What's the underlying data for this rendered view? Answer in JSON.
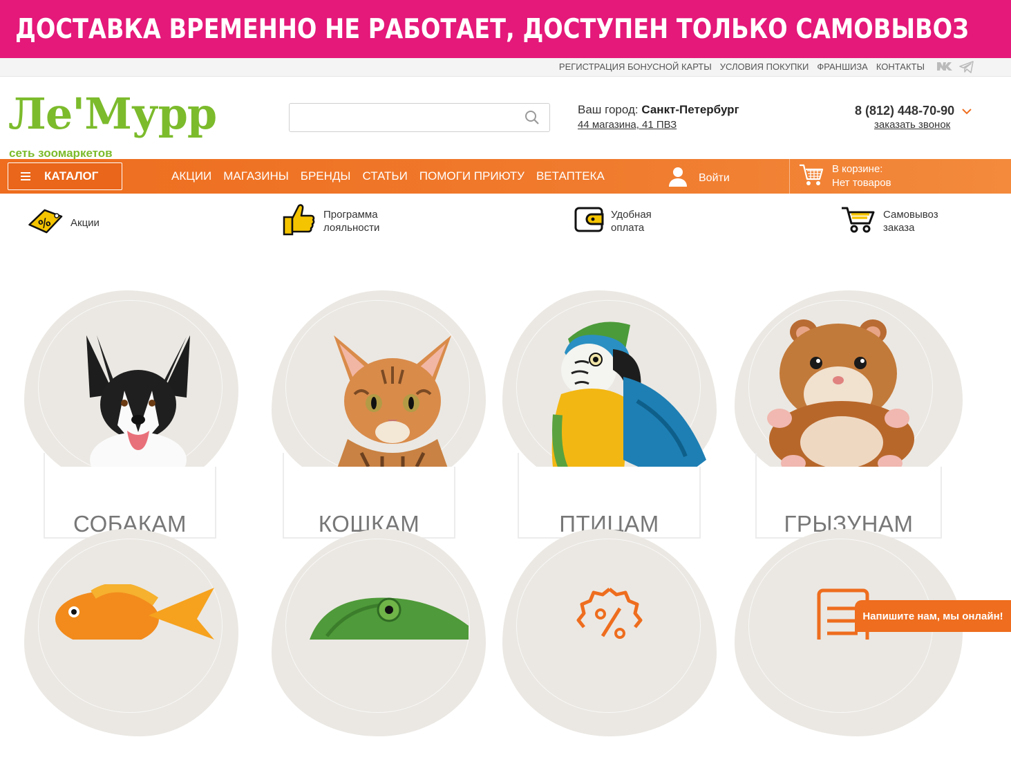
{
  "banner": {
    "text": "ДОСТАВКА ВРЕМЕННО НЕ РАБОТАЕТ, ДОСТУПЕН ТОЛЬКО САМОВЫВОЗ",
    "color": "#e4197a"
  },
  "toplinks": [
    "РЕГИСТРАЦИЯ БОНУСНОЙ КАРТЫ",
    "УСЛОВИЯ ПОКУПКИ",
    "ФРАНШИЗА",
    "КОНТАКТЫ"
  ],
  "social": [
    "vk-icon",
    "telegram-icon"
  ],
  "logo": {
    "main": "Ле'Мурр",
    "sub": "сеть зоомаркетов",
    "color": "#7cbb2c"
  },
  "search": {
    "value": "",
    "placeholder": ""
  },
  "city": {
    "label": "Ваш город:",
    "name": "Санкт-Петербург",
    "stores": "44 магазина, 41 ПВЗ"
  },
  "phone": {
    "number": "8 (812) 448-70-90",
    "callback": "заказать звонок"
  },
  "nav": {
    "catalog": "КАТАЛОГ",
    "items": [
      "АКЦИИ",
      "МАГАЗИНЫ",
      "БРЕНДЫ",
      "СТАТЬИ",
      "ПОМОГИ ПРИЮТУ",
      "ВЕТАПТЕКА"
    ],
    "login": "Войти",
    "cart_title": "В корзине:",
    "cart_status": "Нет товаров",
    "accent": "#ee6d1e"
  },
  "features": [
    {
      "l1": "Акции",
      "l2": "",
      "icon": "discount-tag-icon"
    },
    {
      "l1": "Программа",
      "l2": "лояльности",
      "icon": "thumbs-up-icon"
    },
    {
      "l1": "Удобная",
      "l2": "оплата",
      "icon": "wallet-icon"
    },
    {
      "l1": "Самовывоз",
      "l2": "заказа",
      "icon": "cart-icon"
    }
  ],
  "categories": [
    {
      "label": "СОБАКАМ",
      "image": "dog"
    },
    {
      "label": "КОШКАМ",
      "image": "cat"
    },
    {
      "label": "ПТИЦАМ",
      "image": "parrot"
    },
    {
      "label": "ГРЫЗУНАМ",
      "image": "hamster"
    },
    {
      "label": "",
      "image": "goldfish"
    },
    {
      "label": "",
      "image": "chameleon"
    },
    {
      "label": "",
      "image": "percent-badge"
    },
    {
      "label": "",
      "image": "document"
    }
  ],
  "chat": {
    "text": "Напишите нам, мы онлайн!"
  }
}
